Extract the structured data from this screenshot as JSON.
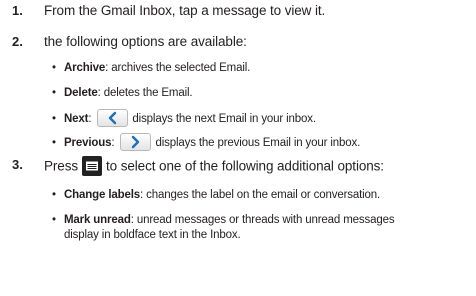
{
  "steps": [
    {
      "number": "1.",
      "text": "From the Gmail Inbox, tap a message to view it."
    },
    {
      "number": "2.",
      "text": "the following options are available:"
    },
    {
      "number": "3.",
      "text_before": "Press",
      "menu_icon": "menu-key-icon",
      "text_after": "to select one of the following additional options:"
    }
  ],
  "options": [
    {
      "bullet": "•",
      "term": "Archive",
      "desc": ": archives the selected Email."
    },
    {
      "bullet": "•",
      "term": "Delete",
      "desc": ": deletes the Email."
    },
    {
      "bullet": "•",
      "term": "Next",
      "sep": ":",
      "icon": "chevron-left-icon",
      "desc": "displays the next Email in your inbox."
    },
    {
      "bullet": "•",
      "term": "Previous",
      "sep": ":",
      "icon": "chevron-right-icon",
      "desc": "displays the previous Email in your inbox."
    }
  ],
  "additional": [
    {
      "bullet": "•",
      "term": "Change labels",
      "desc": ": changes the label on the email or conversation."
    },
    {
      "bullet": "•",
      "term": "Mark unread",
      "desc": ": unread messages or threads with unread messages",
      "desc_line2": "display in boldface text in the Inbox."
    }
  ]
}
